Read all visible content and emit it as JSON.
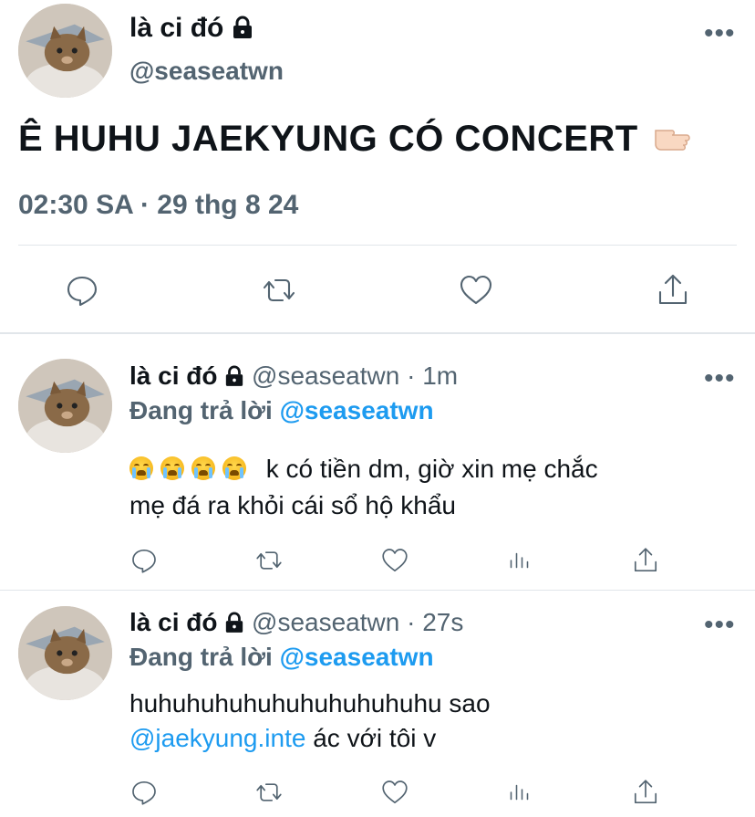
{
  "main_tweet": {
    "display_name": "là ci đó",
    "handle": "@seaseatwn",
    "text": "Ê HUHU JAEKYUNG CÓ CONCERT",
    "timestamp": "02:30 SA · 29 thg 8 24",
    "more": "•••"
  },
  "replies": [
    {
      "display_name": "là ci đó",
      "handle": "@seaseatwn",
      "time": "· 1m",
      "replying_prefix": "Đang trả lời",
      "replying_to": "@seaseatwn",
      "text_line1": "k có tiền dm, giờ xin mẹ chắc",
      "text_line2": "mẹ đá ra khỏi cái sổ hộ khẩu",
      "more": "•••"
    },
    {
      "display_name": "là ci đó",
      "handle": "@seaseatwn",
      "time": "· 27s",
      "replying_prefix": "Đang trả lời",
      "replying_to": "@seaseatwn",
      "text_line1": "huhuhuhuhuhuhuhuhuhuhu sao",
      "mention": "@jaekyung.inte",
      "text_line2_rest": "ác với tôi v",
      "more": "•••"
    }
  ],
  "icons": [
    "reply-icon",
    "retweet-icon",
    "like-icon",
    "analytics-icon",
    "share-icon",
    "lock-icon",
    "pointing-hand-emoji",
    "crying-face-emoji"
  ],
  "colors": {
    "text": "#0f1419",
    "secondary": "#536471",
    "link": "#1d9bf0",
    "divider": "#e1e6ea"
  }
}
